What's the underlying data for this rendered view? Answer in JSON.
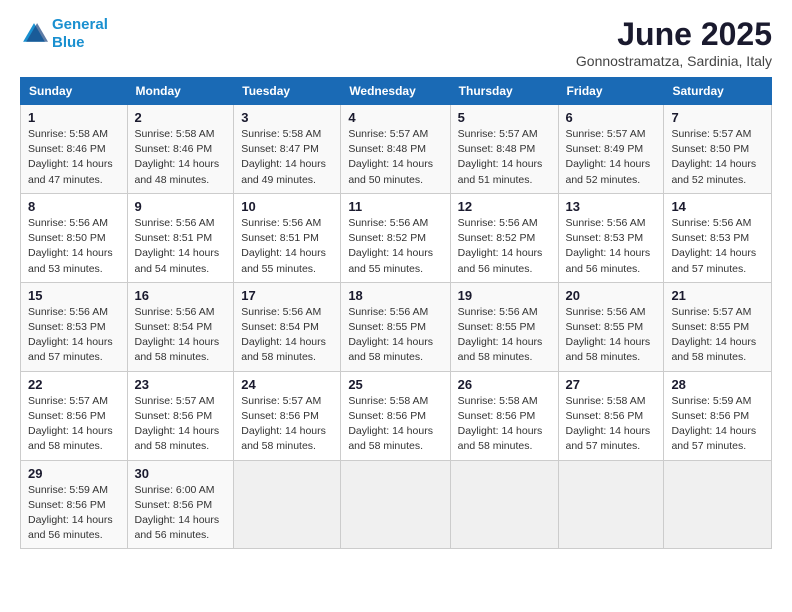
{
  "header": {
    "logo_line1": "General",
    "logo_line2": "Blue",
    "month_title": "June 2025",
    "location": "Gonnostramatza, Sardinia, Italy"
  },
  "days_of_week": [
    "Sunday",
    "Monday",
    "Tuesday",
    "Wednesday",
    "Thursday",
    "Friday",
    "Saturday"
  ],
  "weeks": [
    [
      {
        "day": 1,
        "detail": "Sunrise: 5:58 AM\nSunset: 8:46 PM\nDaylight: 14 hours\nand 47 minutes."
      },
      {
        "day": 2,
        "detail": "Sunrise: 5:58 AM\nSunset: 8:46 PM\nDaylight: 14 hours\nand 48 minutes."
      },
      {
        "day": 3,
        "detail": "Sunrise: 5:58 AM\nSunset: 8:47 PM\nDaylight: 14 hours\nand 49 minutes."
      },
      {
        "day": 4,
        "detail": "Sunrise: 5:57 AM\nSunset: 8:48 PM\nDaylight: 14 hours\nand 50 minutes."
      },
      {
        "day": 5,
        "detail": "Sunrise: 5:57 AM\nSunset: 8:48 PM\nDaylight: 14 hours\nand 51 minutes."
      },
      {
        "day": 6,
        "detail": "Sunrise: 5:57 AM\nSunset: 8:49 PM\nDaylight: 14 hours\nand 52 minutes."
      },
      {
        "day": 7,
        "detail": "Sunrise: 5:57 AM\nSunset: 8:50 PM\nDaylight: 14 hours\nand 52 minutes."
      }
    ],
    [
      {
        "day": 8,
        "detail": "Sunrise: 5:56 AM\nSunset: 8:50 PM\nDaylight: 14 hours\nand 53 minutes."
      },
      {
        "day": 9,
        "detail": "Sunrise: 5:56 AM\nSunset: 8:51 PM\nDaylight: 14 hours\nand 54 minutes."
      },
      {
        "day": 10,
        "detail": "Sunrise: 5:56 AM\nSunset: 8:51 PM\nDaylight: 14 hours\nand 55 minutes."
      },
      {
        "day": 11,
        "detail": "Sunrise: 5:56 AM\nSunset: 8:52 PM\nDaylight: 14 hours\nand 55 minutes."
      },
      {
        "day": 12,
        "detail": "Sunrise: 5:56 AM\nSunset: 8:52 PM\nDaylight: 14 hours\nand 56 minutes."
      },
      {
        "day": 13,
        "detail": "Sunrise: 5:56 AM\nSunset: 8:53 PM\nDaylight: 14 hours\nand 56 minutes."
      },
      {
        "day": 14,
        "detail": "Sunrise: 5:56 AM\nSunset: 8:53 PM\nDaylight: 14 hours\nand 57 minutes."
      }
    ],
    [
      {
        "day": 15,
        "detail": "Sunrise: 5:56 AM\nSunset: 8:53 PM\nDaylight: 14 hours\nand 57 minutes."
      },
      {
        "day": 16,
        "detail": "Sunrise: 5:56 AM\nSunset: 8:54 PM\nDaylight: 14 hours\nand 58 minutes."
      },
      {
        "day": 17,
        "detail": "Sunrise: 5:56 AM\nSunset: 8:54 PM\nDaylight: 14 hours\nand 58 minutes."
      },
      {
        "day": 18,
        "detail": "Sunrise: 5:56 AM\nSunset: 8:55 PM\nDaylight: 14 hours\nand 58 minutes."
      },
      {
        "day": 19,
        "detail": "Sunrise: 5:56 AM\nSunset: 8:55 PM\nDaylight: 14 hours\nand 58 minutes."
      },
      {
        "day": 20,
        "detail": "Sunrise: 5:56 AM\nSunset: 8:55 PM\nDaylight: 14 hours\nand 58 minutes."
      },
      {
        "day": 21,
        "detail": "Sunrise: 5:57 AM\nSunset: 8:55 PM\nDaylight: 14 hours\nand 58 minutes."
      }
    ],
    [
      {
        "day": 22,
        "detail": "Sunrise: 5:57 AM\nSunset: 8:56 PM\nDaylight: 14 hours\nand 58 minutes."
      },
      {
        "day": 23,
        "detail": "Sunrise: 5:57 AM\nSunset: 8:56 PM\nDaylight: 14 hours\nand 58 minutes."
      },
      {
        "day": 24,
        "detail": "Sunrise: 5:57 AM\nSunset: 8:56 PM\nDaylight: 14 hours\nand 58 minutes."
      },
      {
        "day": 25,
        "detail": "Sunrise: 5:58 AM\nSunset: 8:56 PM\nDaylight: 14 hours\nand 58 minutes."
      },
      {
        "day": 26,
        "detail": "Sunrise: 5:58 AM\nSunset: 8:56 PM\nDaylight: 14 hours\nand 58 minutes."
      },
      {
        "day": 27,
        "detail": "Sunrise: 5:58 AM\nSunset: 8:56 PM\nDaylight: 14 hours\nand 57 minutes."
      },
      {
        "day": 28,
        "detail": "Sunrise: 5:59 AM\nSunset: 8:56 PM\nDaylight: 14 hours\nand 57 minutes."
      }
    ],
    [
      {
        "day": 29,
        "detail": "Sunrise: 5:59 AM\nSunset: 8:56 PM\nDaylight: 14 hours\nand 56 minutes."
      },
      {
        "day": 30,
        "detail": "Sunrise: 6:00 AM\nSunset: 8:56 PM\nDaylight: 14 hours\nand 56 minutes."
      },
      null,
      null,
      null,
      null,
      null
    ]
  ]
}
